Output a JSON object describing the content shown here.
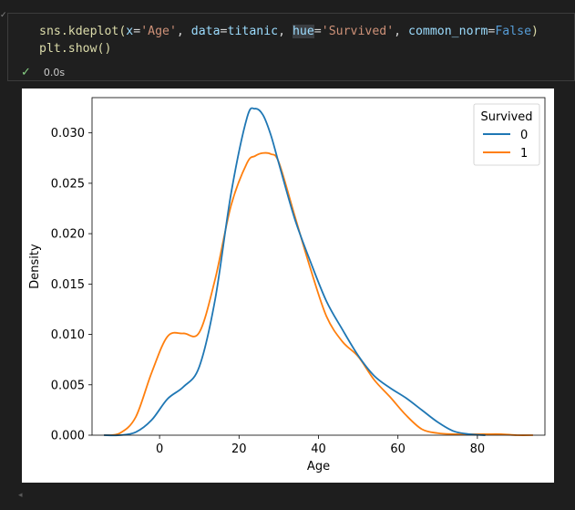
{
  "code": {
    "line1": {
      "fn": "sns.kdeplot(",
      "x_kw": "x",
      "x_val": "'Age'",
      "data_kw": "data",
      "data_val": "titanic",
      "hue_kw": "hue",
      "hue_val": "'Survived'",
      "norm_kw": "common_norm",
      "norm_val": "False"
    },
    "line2": "plt.show()"
  },
  "execution": {
    "status_icon": "check-icon",
    "time": "0.0s"
  },
  "colors": {
    "series0": "#1f77b4",
    "series1": "#ff7f0e"
  },
  "chart_data": {
    "type": "line",
    "xlabel": "Age",
    "ylabel": "Density",
    "xlim": [
      -17,
      97
    ],
    "ylim": [
      0,
      0.0335
    ],
    "xticks": [
      0,
      20,
      40,
      60,
      80
    ],
    "yticks": [
      0.0,
      0.005,
      0.01,
      0.015,
      0.02,
      0.025,
      0.03
    ],
    "ytick_labels": [
      "0.000",
      "0.005",
      "0.010",
      "0.015",
      "0.020",
      "0.025",
      "0.030"
    ],
    "grid": false,
    "legend": {
      "title": "Survived",
      "placement": "top-right"
    },
    "x": [
      -14,
      -10,
      -6,
      -2,
      2,
      6,
      10,
      14,
      18,
      22,
      24,
      26,
      28,
      30,
      34,
      38,
      42,
      46,
      50,
      54,
      58,
      62,
      66,
      70,
      74,
      78,
      82,
      86,
      90,
      94
    ],
    "series": [
      {
        "name": "0",
        "values": [
          0.0,
          0.0,
          0.0003,
          0.0015,
          0.0036,
          0.0048,
          0.0068,
          0.0135,
          0.024,
          0.0315,
          0.0324,
          0.0318,
          0.0298,
          0.027,
          0.0215,
          0.0172,
          0.0133,
          0.0105,
          0.0079,
          0.0059,
          0.0047,
          0.0037,
          0.0025,
          0.0013,
          0.0004,
          0.0001,
          0.0,
          null,
          null,
          null
        ]
      },
      {
        "name": "1",
        "values": [
          0.0,
          0.0002,
          0.0018,
          0.0062,
          0.0098,
          0.0101,
          0.0102,
          0.0155,
          0.0228,
          0.027,
          0.0277,
          0.028,
          0.0279,
          0.0271,
          0.0218,
          0.0165,
          0.0118,
          0.0093,
          0.0078,
          0.0055,
          0.0038,
          0.002,
          0.0006,
          0.0002,
          0.0001,
          0.0001,
          0.0001,
          0.0001,
          0.0,
          0.0
        ]
      }
    ]
  }
}
